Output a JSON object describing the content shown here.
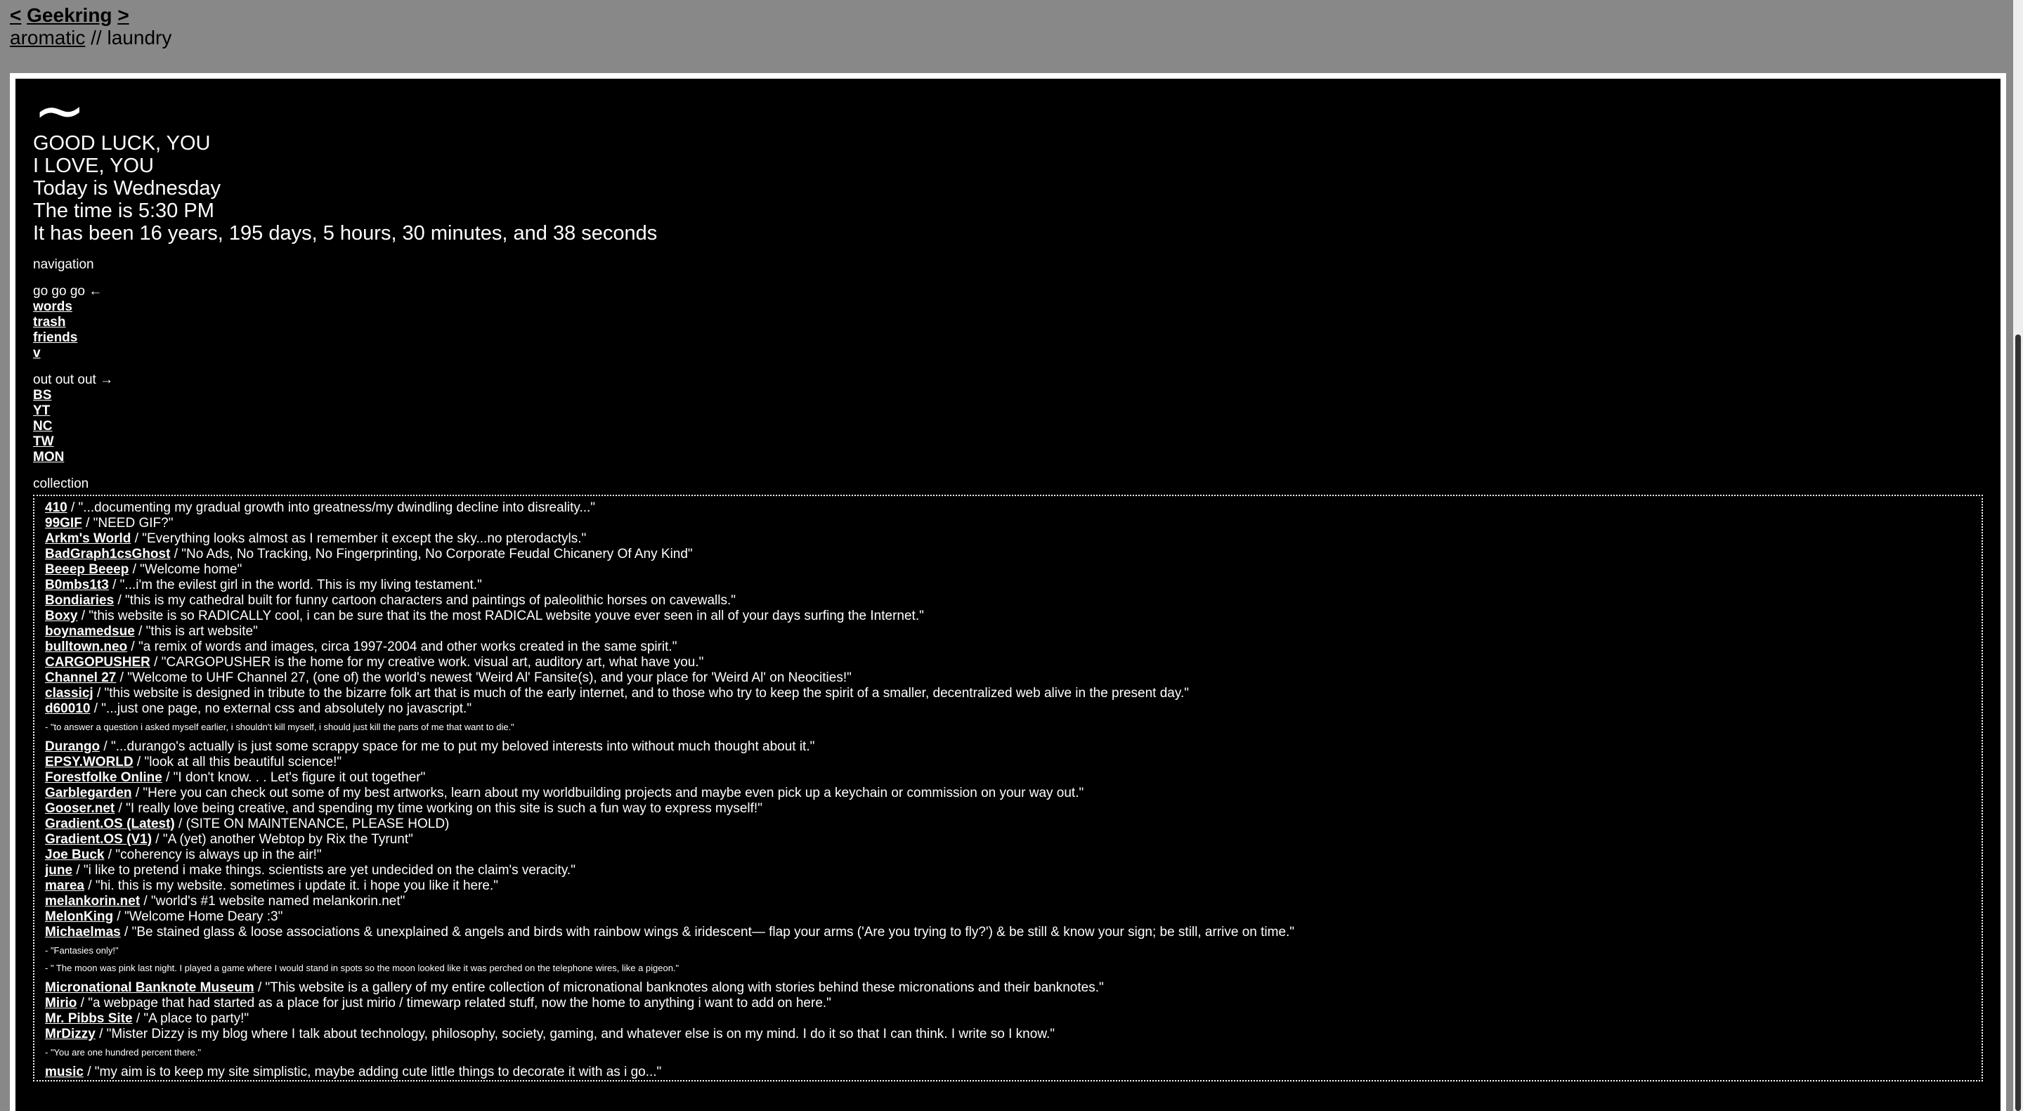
{
  "header": {
    "prev": "<",
    "ring_name": "Geekring",
    "next": ">",
    "site_link": "aromatic",
    "separator": " // ",
    "site_section": "laundry"
  },
  "intro": {
    "tilde": "~",
    "lines": [
      "GOOD LUCK, YOU",
      "I LOVE, YOU",
      "Today is Wednesday",
      "The time is 5:30 PM",
      "It has been 16 years, 195 days, 5 hours, 30 minutes, and 38 seconds"
    ]
  },
  "navigation": {
    "heading": "navigation",
    "go_label": "go go go ←",
    "go_links": [
      "words",
      "trash",
      "friends",
      "v"
    ],
    "out_label": "out out out →",
    "out_links": [
      "BS",
      "YT",
      "NC",
      "TW",
      "MON"
    ]
  },
  "collection": {
    "heading": "collection",
    "items": [
      {
        "name": "410",
        "desc": " / \"...documenting my gradual growth into greatness/my dwindling decline into disreality...\""
      },
      {
        "name": "99GIF",
        "desc": " / \"NEED GIF?\""
      },
      {
        "name": "Arkm's World",
        "desc": " / \"Everything looks almost as I remember it except the sky...no pterodactyls.\""
      },
      {
        "name": "BadGraph1csGhost",
        "desc": " / \"No Ads, No Tracking, No Fingerprinting, No Corporate Feudal Chicanery Of Any Kind\""
      },
      {
        "name": "Beeep Beeep",
        "desc": " / \"Welcome home\""
      },
      {
        "name": "B0mbs1t3",
        "desc": " / \"...i'm the evilest girl in the world. This is my living testament.\""
      },
      {
        "name": "Bondiaries",
        "desc": " / \"this is my cathedral built for funny cartoon characters and paintings of paleolithic horses on cavewalls.\""
      },
      {
        "name": "Boxy",
        "desc": " / \"this website is so RADICALLY cool, i can be sure that its the most RADICAL website youve ever seen in all of your days surfing the Internet.\""
      },
      {
        "name": "boynamedsue",
        "desc": " / \"this is art website\""
      },
      {
        "name": "bulltown.neo",
        "desc": " / \"a remix of words and images, circa 1997-2004 and other works created in the same spirit.\""
      },
      {
        "name": "CARGOPUSHER",
        "desc": " / \"CARGOPUSHER is the home for my creative work. visual art, auditory art, what have you.\""
      },
      {
        "name": "Channel 27",
        "desc": " / \"Welcome to UHF Channel 27, (one of) the world's newest 'Weird Al' Fansite(s), and your place for 'Weird Al' on Neocities!\""
      },
      {
        "name": "classicj",
        "desc": " / \"this website is designed in tribute to the bizarre folk art that is much of the early internet, and to those who try to keep the spirit of a smaller, decentralized web alive in the present day.\""
      },
      {
        "name": "d60010",
        "desc": " / \"...just one page, no external css and absolutely no javascript.\""
      },
      {
        "note": "- \"to answer a question i asked myself earlier, i shouldn't kill myself, i should just kill the parts of me that want to die.\""
      },
      {
        "name": "Durango",
        "desc": " / \"...durango's actually is just some scrappy space for me to put my beloved interests into without much thought about it.\""
      },
      {
        "name": "EPSY.WORLD",
        "desc": " / \"look at all this beautiful science!\""
      },
      {
        "name": "Forestfolke Online",
        "desc": " / \"I don't know. . . Let's figure it out together\""
      },
      {
        "name": "Garblegarden",
        "desc": " / \"Here you can check out some of my best artworks, learn about my worldbuilding projects and maybe even pick up a keychain or commission on your way out.\""
      },
      {
        "name": "Gooser.net",
        "desc": " / \"I really love being creative, and spending my time working on this site is such a fun way to express myself!\""
      },
      {
        "name": "Gradient.OS (Latest)",
        "desc": " / (SITE ON MAINTENANCE, PLEASE HOLD)"
      },
      {
        "name": "Gradient.OS (V1)",
        "desc": " / \"A (yet) another Webtop by Rix the Tyrunt\""
      },
      {
        "name": "Joe Buck",
        "desc": " / \"coherency is always up in the air!\""
      },
      {
        "name": "june",
        "desc": " / \"i like to pretend i make things. scientists are yet undecided on the claim's veracity.\""
      },
      {
        "name": "marea",
        "desc": " / \"hi. this is my website. sometimes i update it. i hope you like it here.\""
      },
      {
        "name": "melankorin.net",
        "desc": " / \"world's #1 website named melankorin.net\""
      },
      {
        "name": "MelonKing",
        "desc": " / \"Welcome Home Deary :3\""
      },
      {
        "name": "Michaelmas",
        "desc": " / \"Be stained glass & loose associations & unexplained & angels and birds with rainbow wings & iridescent— flap your arms ('Are you trying to fly?') & be still & know your sign; be still, arrive on time.\""
      },
      {
        "note": "- \"Fantasies only!\""
      },
      {
        "note": "- \" The moon was pink last night. I played a game where I would stand in spots so the moon looked like it was perched on the telephone wires, like a pigeon.\""
      },
      {
        "name": "Micronational Banknote Museum",
        "desc": " / \"This website is a gallery of my entire collection of micronational banknotes along with stories behind these micronations and their banknotes.\""
      },
      {
        "name": "Mirio",
        "desc": " / \"a webpage that had started as a place for just mirio / timewarp related stuff, now the home to anything i want to add on here.\""
      },
      {
        "name": "Mr. Pibbs Site",
        "desc": " / \"A place to party!\""
      },
      {
        "name": "MrDizzy",
        "desc": " / \"Mister Dizzy is my blog where I talk about technology, philosophy, society, gaming, and whatever else is on my mind. I do it so that I can think. I write so I know.\""
      },
      {
        "note": "- \"You are one hundred percent there.\""
      },
      {
        "name": "music",
        "desc": " / \"my aim is to keep my site simplistic, maybe adding cute little things to decorate it with as i go...\""
      }
    ]
  }
}
